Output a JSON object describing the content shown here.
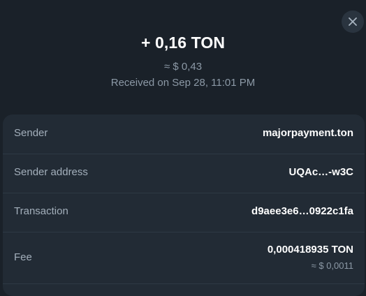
{
  "header": {
    "amount": "+ 0,16 TON",
    "fiat_value": "≈ $ 0,43",
    "received_text": "Received on Sep 28, 11:01 PM",
    "close_icon": "close-icon"
  },
  "details": {
    "sender": {
      "label": "Sender",
      "value": "majorpayment.ton"
    },
    "sender_address": {
      "label": "Sender address",
      "value": "UQAc…-w3C"
    },
    "transaction": {
      "label": "Transaction",
      "value": "d9aee3e6…0922c1fa"
    },
    "fee": {
      "label": "Fee",
      "value": "0,000418935 TON",
      "fiat": "≈ $ 0,0011"
    }
  },
  "colors": {
    "background": "#1a2129",
    "card": "#222b35",
    "muted_text": "#8c99a6",
    "primary_text": "#ffffff"
  }
}
